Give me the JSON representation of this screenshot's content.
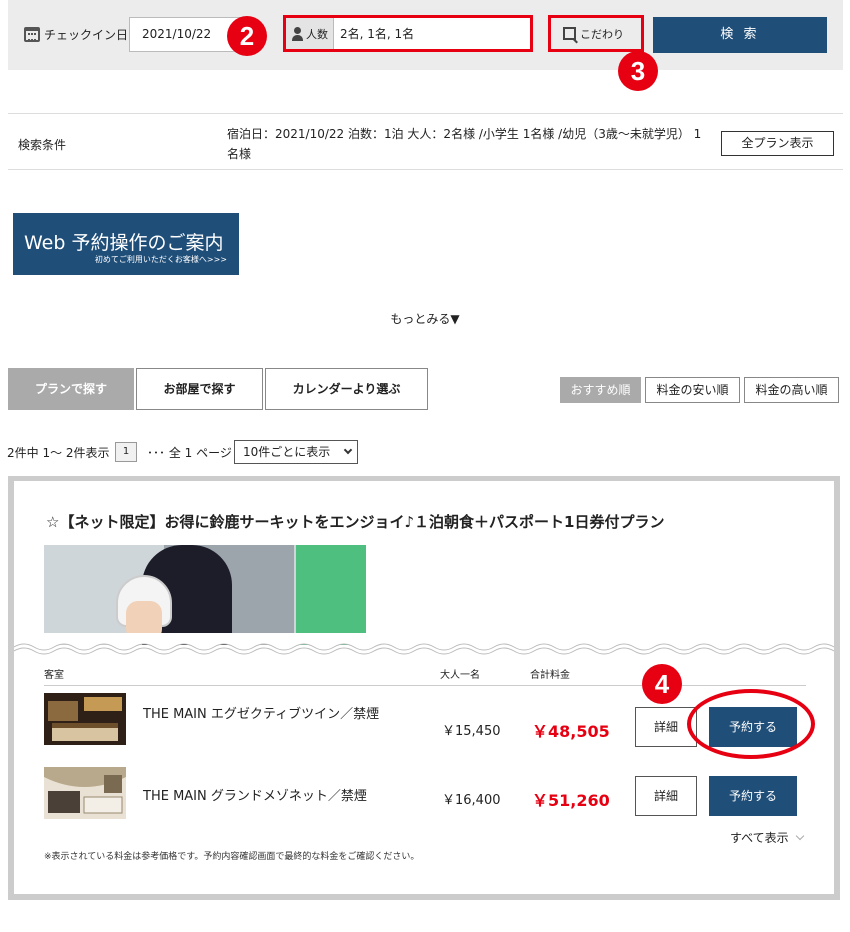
{
  "search": {
    "checkin_label": "チェックイン日",
    "checkin_date": "2021/10/22",
    "people_label": "人数",
    "people_value": "2名, 1名, 1名",
    "kodawari_label": "こだわり",
    "search_button": "検 索"
  },
  "badges": {
    "two": "2",
    "three": "3",
    "four": "4"
  },
  "conditions": {
    "label": "検索条件",
    "text": "宿泊日：2021/10/22 泊数：1泊 大人：2名様 /小学生 1名様 /幼児（3歳〜未就学児） 1名様",
    "all_plans_button": "全プラン表示"
  },
  "banner": {
    "title": "Web 予約操作のご案内",
    "subtitle": "初めてご利用いただくお客様へ>>>"
  },
  "more_link": "もっとみる▼",
  "tabs": [
    {
      "label": "プランで探す",
      "active": true
    },
    {
      "label": "お部屋で探す",
      "active": false
    },
    {
      "label": "カレンダーより選ぶ",
      "active": false
    }
  ],
  "sort": [
    {
      "label": "おすすめ順",
      "active": true
    },
    {
      "label": "料金の安い順",
      "active": false
    },
    {
      "label": "料金の高い順",
      "active": false
    }
  ],
  "pagination": {
    "count_text": "2件中 1〜 2件表示",
    "current_page": "1",
    "total_text": "･･･ 全 1 ページ",
    "per_page": "10件ごとに表示"
  },
  "plan": {
    "title": "☆【ネット限定】お得に鈴鹿サーキットをエンジョイ♪１泊朝食＋パスポート1日券付プラン",
    "columns": {
      "room": "客室",
      "adult": "大人一名",
      "total": "合計料金"
    },
    "rooms": [
      {
        "name": "THE MAIN エグゼクティブツイン／禁煙",
        "adult_price": "￥15,450",
        "total_price": "￥48,505",
        "detail_button": "詳細",
        "reserve_button": "予約する"
      },
      {
        "name": "THE MAIN グランドメゾネット／禁煙",
        "adult_price": "￥16,400",
        "total_price": "￥51,260",
        "detail_button": "詳細",
        "reserve_button": "予約する"
      }
    ],
    "show_all": "すべて表示",
    "note": "※表示されている料金は参考価格です。予約内容確認画面で最終的な料金をご確認ください。"
  },
  "colors": {
    "accent": "#1f4e79",
    "highlight": "#e60012",
    "price": "#e60012"
  },
  "icons": [
    "calendar-icon",
    "person-icon",
    "search-icon",
    "chevron-down-icon"
  ]
}
